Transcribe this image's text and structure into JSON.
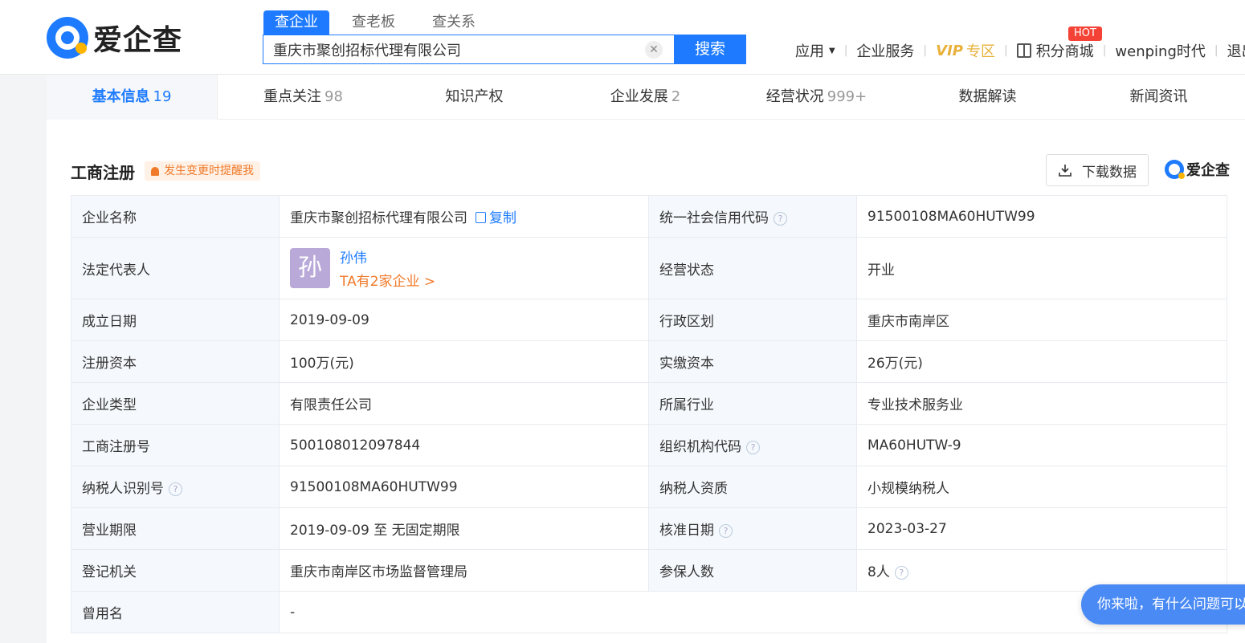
{
  "header": {
    "logo_text": "爱企查",
    "search_tabs": [
      "查企业",
      "查老板",
      "查关系"
    ],
    "search_value": "重庆市聚创招标代理有限公司",
    "search_button": "搜索",
    "nav": {
      "apps": "应用",
      "enterprise_service": "企业服务",
      "vip": "VIP",
      "vip_zone": "专区",
      "points_mall": "积分商城",
      "hot_badge": "HOT",
      "username": "wenping时代",
      "logout": "退出"
    }
  },
  "tabs": [
    {
      "label": "基本信息",
      "count": "19"
    },
    {
      "label": "重点关注",
      "count": "98"
    },
    {
      "label": "知识产权",
      "count": ""
    },
    {
      "label": "企业发展",
      "count": "2"
    },
    {
      "label": "经营状况",
      "count": "999+"
    },
    {
      "label": "数据解读",
      "count": ""
    },
    {
      "label": "新闻资讯",
      "count": ""
    }
  ],
  "section": {
    "title": "工商注册",
    "remind": "发生变更时提醒我",
    "download": "下载数据",
    "brand": "爱企查"
  },
  "info": {
    "company_name_label": "企业名称",
    "company_name": "重庆市聚创招标代理有限公司",
    "copy": "复制",
    "credit_code_label": "统一社会信用代码",
    "credit_code": "91500108MA60HUTW99",
    "legal_rep_label": "法定代表人",
    "legal_rep_avatar": "孙",
    "legal_rep_name": "孙伟",
    "legal_rep_more": "TA有2家企业 >",
    "status_label": "经营状态",
    "status": "开业",
    "founded_label": "成立日期",
    "founded": "2019-09-09",
    "district_label": "行政区划",
    "district": "重庆市南岸区",
    "reg_capital_label": "注册资本",
    "reg_capital": "100万(元)",
    "paid_capital_label": "实缴资本",
    "paid_capital": "26万(元)",
    "type_label": "企业类型",
    "type": "有限责任公司",
    "industry_label": "所属行业",
    "industry": "专业技术服务业",
    "reg_no_label": "工商注册号",
    "reg_no": "500108012097844",
    "org_code_label": "组织机构代码",
    "org_code": "MA60HUTW-9",
    "taxpayer_id_label": "纳税人识别号",
    "taxpayer_id": "91500108MA60HUTW99",
    "taxpayer_qual_label": "纳税人资质",
    "taxpayer_qual": "小规模纳税人",
    "term_label": "营业期限",
    "term": "2019-09-09 至 无固定期限",
    "approve_label": "核准日期",
    "approve": "2023-03-27",
    "authority_label": "登记机关",
    "authority": "重庆市南岸区市场监督管理局",
    "insured_label": "参保人数",
    "insured": "8人",
    "former_name_label": "曾用名",
    "former_name": "-"
  },
  "chat": {
    "text": "你来啦，有什么问题可以"
  }
}
